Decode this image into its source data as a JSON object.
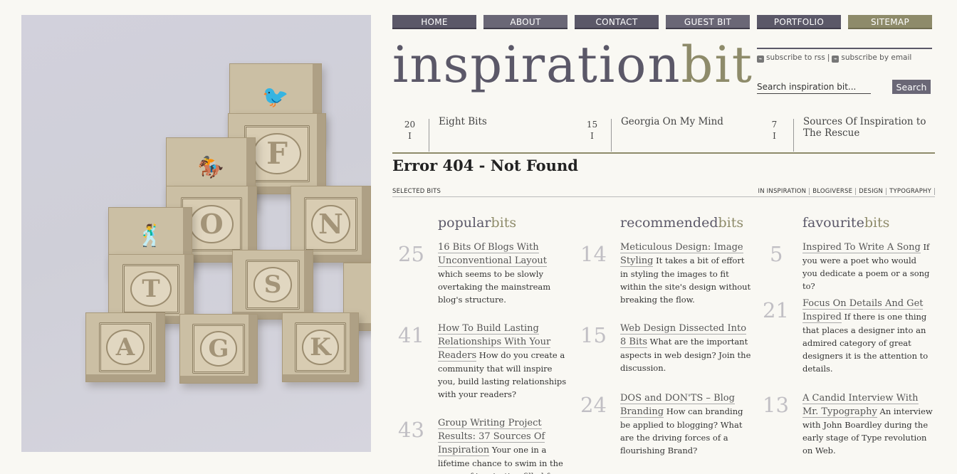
{
  "nav": [
    "HOME",
    "ABOUT",
    "CONTACT",
    "GUEST BIT",
    "PORTFOLIO",
    "SITEMAP"
  ],
  "logo": {
    "main": "inspiration",
    "accent": "bit"
  },
  "subscribe": {
    "rss": "subscribe to rss",
    "email": "subscribe by email"
  },
  "search": {
    "placeholder": "Search inspiration bit...",
    "button": "Search"
  },
  "photo_blocks": [
    "F",
    "O",
    "N",
    "T",
    "S",
    "A",
    "G",
    "K"
  ],
  "featured": [
    {
      "day": "20",
      "month": "I",
      "title": "Eight Bits"
    },
    {
      "day": "15",
      "month": "I",
      "title": "Georgia On My Mind"
    },
    {
      "day": "7",
      "month": "I",
      "title": "Sources Of Inspiration to The Rescue"
    }
  ],
  "error_title": "Error 404 - Not Found",
  "selected_bits": "SELECTED BITS",
  "categories": [
    "IN INSPIRATION",
    "BLOGIVERSE",
    "DESIGN",
    "TYPOGRAPHY"
  ],
  "columns": [
    {
      "title_main": "popular",
      "title_accent": "bits",
      "items": [
        {
          "num": "25",
          "link": "16 Bits Of Blogs With Unconventional Layout",
          "desc": "which seems to be slowly overtaking the mainstream blog's structure."
        },
        {
          "num": "41",
          "link": "How To Build Lasting Relationships With Your Readers",
          "desc": "How do you create a community that will inspire you, build lasting relationships with your readers?"
        },
        {
          "num": "43",
          "link": "Group Writing Project Results: 37 Sources Of Inspiration",
          "desc": "Your one in a lifetime chance to swim in the ocean of inspiration filled from"
        }
      ]
    },
    {
      "title_main": "recommended",
      "title_accent": "bits",
      "items": [
        {
          "num": "14",
          "link": "Meticulous Design: Image Styling",
          "desc": "It takes a bit of effort in styling the images to fit within the site's design without breaking the flow."
        },
        {
          "num": "15",
          "link": "Web Design Dissected Into 8 Bits",
          "desc": "What are the important aspects in web design? Join the discussion."
        },
        {
          "num": "24",
          "link": "DOS and DON'TS – Blog Branding",
          "desc": "How can branding be applied to blogging? What are the driving forces of a flourishing Brand?"
        }
      ]
    },
    {
      "title_main": "favourite",
      "title_accent": "bits",
      "items": [
        {
          "num": "5",
          "link": "Inspired To Write A Song",
          "desc": "If you were a poet who would you dedicate a poem or a song to?"
        },
        {
          "num": "21",
          "link": "Focus On Details And Get Inspired",
          "desc": "If there is one thing that places a designer into an admired category of great designers it is the attention to details."
        },
        {
          "num": "13",
          "link": "A Candid Interview With Mr. Typography",
          "desc": "An interview with John Boardley during the early stage of Type revolution on Web."
        }
      ]
    }
  ]
}
